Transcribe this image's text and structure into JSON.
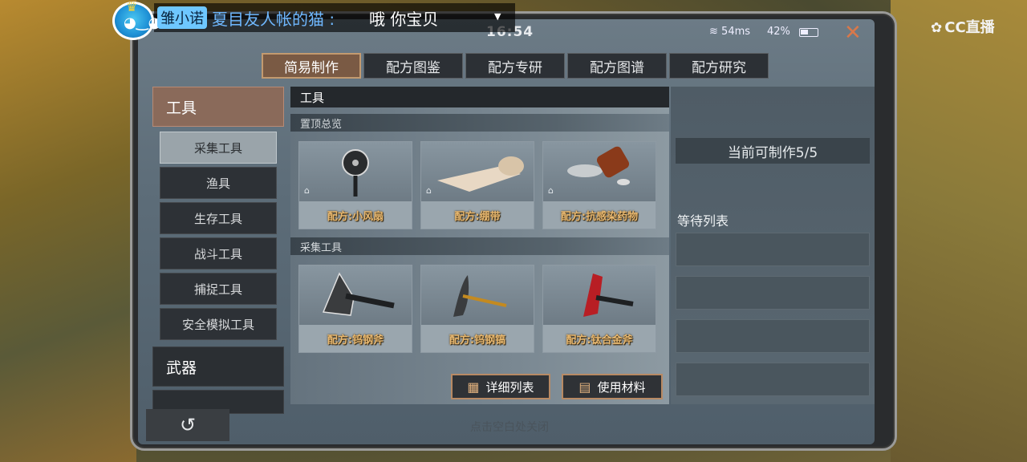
{
  "status": {
    "time": "16:54",
    "wifi": "54ms",
    "battery": "42%"
  },
  "tabs": [
    {
      "label": "简易制作",
      "active": true
    },
    {
      "label": "配方图鉴",
      "active": false
    },
    {
      "label": "配方专研",
      "active": false
    },
    {
      "label": "配方图谱",
      "active": false
    },
    {
      "label": "配方研究",
      "active": false
    }
  ],
  "categories": {
    "main": "工具",
    "subs": [
      "采集工具",
      "渔具",
      "生存工具",
      "战斗工具",
      "捕捉工具",
      "安全模拟工具"
    ],
    "weapon": "武器"
  },
  "panel": {
    "header": "工具",
    "section_top": "置顶总览",
    "section_gather": "采集工具",
    "top_items": [
      "配方:小风扇",
      "配方:绷带",
      "配方:抗感染药物"
    ],
    "gather_items": [
      "配方:钨钢斧",
      "配方:钨钢镐",
      "配方:钛合金斧"
    ]
  },
  "buttons": {
    "detail_list": "详细列表",
    "use_material": "使用材料"
  },
  "right": {
    "craft_count": "当前可制作5/5",
    "wait_list": "等待列表"
  },
  "bottom_hint": "点击空白处关闭",
  "overlay": {
    "chat_name": "雏小诺",
    "chat_user": "夏目友人帐的猫 :",
    "chat_msg": "哦  你宝贝",
    "logo": "CC直播"
  },
  "colors": {
    "accent": "#c39a6f",
    "label_gold": "#e8b870",
    "close": "#d9784a"
  }
}
